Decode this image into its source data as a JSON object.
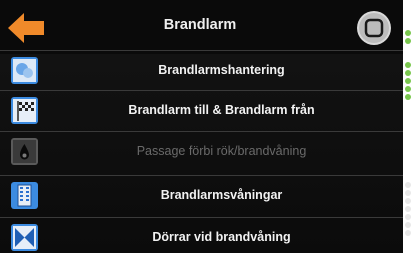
{
  "header": {
    "title": "Brandlarm",
    "back_icon": "back-arrow-icon",
    "home_icon": "home-button-icon",
    "accent": "#f08a2a"
  },
  "menu": {
    "items": [
      {
        "label": "Brandlarmshantering",
        "icon": "fire-alarm-handling-icon",
        "enabled": true
      },
      {
        "label": "Brandlarm till & Brandlarm från",
        "icon": "checkered-flag-icon",
        "enabled": true
      },
      {
        "label": "Passage förbi rök/brandvåning",
        "icon": "smoke-fire-icon",
        "enabled": false
      },
      {
        "label": "Brandlarmsvåningar",
        "icon": "building-floors-icon",
        "enabled": true
      },
      {
        "label": "Dörrar vid brandvåning",
        "icon": "doors-icon",
        "enabled": true
      }
    ]
  },
  "colors": {
    "background": "#111111",
    "text": "#f2f2f2",
    "disabled_text": "#6a6a6a",
    "icon_blue": "#2a6fcf",
    "status_green": "#7ac74f",
    "status_white": "#e8e8e8"
  }
}
